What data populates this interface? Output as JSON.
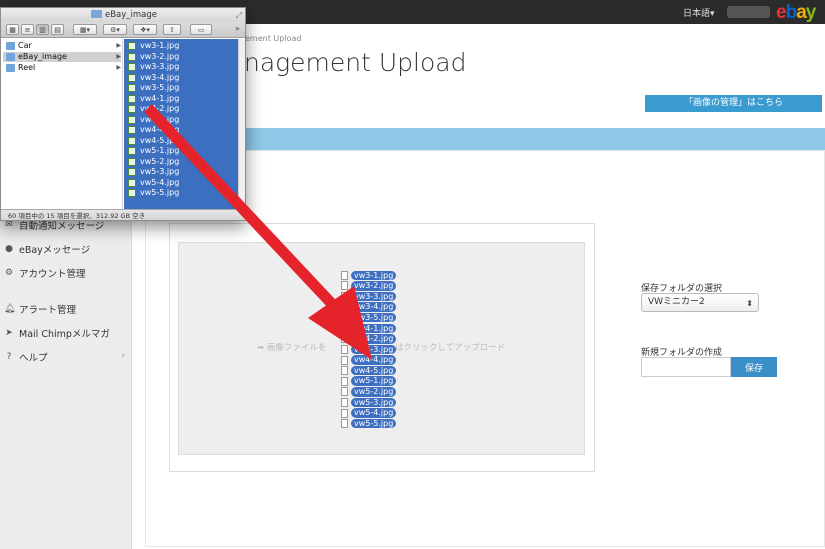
{
  "header": {
    "language": "日本語▾",
    "logo": "ebay"
  },
  "sidebar": {
    "items": [
      {
        "label": "自動通知メッセージ",
        "icon": "mail-icon"
      },
      {
        "label": "eBayメッセージ",
        "icon": "chat-bubble-icon"
      },
      {
        "label": "アカウント管理",
        "icon": "gears-icon"
      },
      {
        "label": "アラート管理",
        "icon": "bell-icon"
      },
      {
        "label": "Mail Chimpメルマガ",
        "icon": "send-icon"
      },
      {
        "label": "ヘルプ",
        "icon": "question-icon"
      }
    ]
  },
  "main": {
    "breadcrumb": "ement Upload",
    "title": "nagement Upload",
    "manage_link": "「画像の管理」はこちら",
    "drop_hint_left": "画像ファイルを",
    "drop_hint_right": "はクリックしてアップロード",
    "folder_label": "保存フォルダの選択",
    "folder_selected": "VWミニカー2",
    "new_folder_label": "新規フォルダの作成",
    "new_folder_value": "",
    "save_label": "保存"
  },
  "finder": {
    "title": "eBay_image",
    "folders": [
      "Car",
      "eBay_image",
      "Reel"
    ],
    "selected_folder": "eBay_image",
    "files": [
      "vw3-1.jpg",
      "vw3-2.jpg",
      "vw3-3.jpg",
      "vw3-4.jpg",
      "vw3-5.jpg",
      "vw4-1.jpg",
      "vw4-2.jpg",
      "vw4-3.jpg",
      "vw4-4.jpg",
      "vw4-5.jpg",
      "vw5-1.jpg",
      "vw5-2.jpg",
      "vw5-3.jpg",
      "vw5-4.jpg",
      "vw5-5.jpg"
    ],
    "status": "60 項目中の 15 項目を選択、312.92 GB 空き"
  },
  "dragged_files": [
    "vw3-1.jpg",
    "vw3-2.jpg",
    "vw3-3.jpg",
    "vw3-4.jpg",
    "vw3-5.jpg",
    "vw4-1.jpg",
    "vw4-2.jpg",
    "vw4-3.jpg",
    "vw4-4.jpg",
    "vw4-5.jpg",
    "vw5-1.jpg",
    "vw5-2.jpg",
    "vw5-3.jpg",
    "vw5-4.jpg",
    "vw5-5.jpg"
  ],
  "colors": {
    "accent": "#3a9bd0",
    "selection": "#3d6fc0",
    "arrow": "#e5232b"
  }
}
